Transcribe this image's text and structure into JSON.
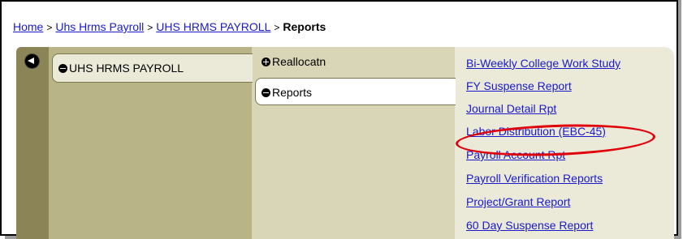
{
  "breadcrumb": {
    "items": [
      "Home",
      "Uhs Hrms Payroll",
      "UHS HRMS PAYROLL"
    ],
    "current": "Reports",
    "separator": ">"
  },
  "menu": {
    "level1": {
      "label": "UHS HRMS PAYROLL",
      "icon": "minus-circle-icon"
    },
    "level2": [
      {
        "label": "Reallocatn",
        "icon": "plus-circle-icon"
      },
      {
        "label": "Reports",
        "icon": "minus-circle-icon"
      }
    ],
    "level3": [
      "Bi-Weekly College Work Study",
      "FY Suspense Report",
      "Journal Detail Rpt",
      "Labor Distribution (EBC-45)",
      "Payroll Account Rpt",
      "Payroll Verification Reports",
      "Project/Grant Report",
      "60 Day Suspense Report"
    ]
  },
  "colors": {
    "link": "#1a1ac9",
    "back_column": "#8a8456",
    "column1": "#b8b487",
    "column2": "#d9d6b7",
    "column3": "#ebe9d8",
    "highlight": "#e0000a"
  }
}
